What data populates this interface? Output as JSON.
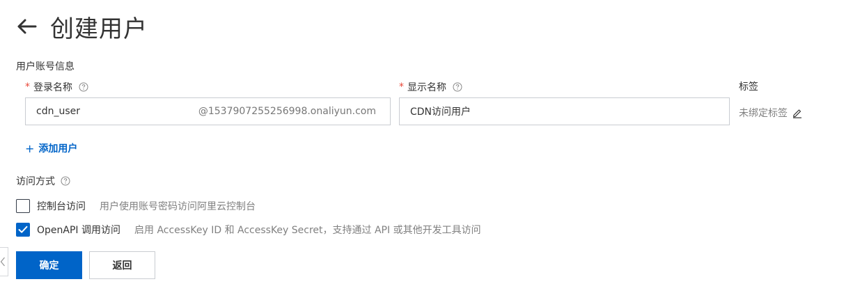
{
  "header": {
    "title": "创建用户",
    "back_icon": "arrow-left-icon"
  },
  "form": {
    "section_title": "用户账号信息",
    "login_name": {
      "label": "登录名称",
      "required": "*",
      "value": "cdn_user",
      "suffix": "@1537907255256998.onaliyun.com"
    },
    "display_name": {
      "label": "显示名称",
      "required": "*",
      "value": "CDN访问用户"
    },
    "tags": {
      "label": "标签",
      "value": "未绑定标签"
    },
    "add_user_label": "添加用户",
    "add_user_plus": "+"
  },
  "access": {
    "title": "访问方式",
    "options": [
      {
        "label": "控制台访问",
        "description": "用户使用账号密码访问阿里云控制台",
        "checked": false
      },
      {
        "label": "OpenAPI 调用访问",
        "description": "启用 AccessKey ID 和 AccessKey Secret，支持通过 API 或其他开发工具访问",
        "checked": true
      }
    ]
  },
  "buttons": {
    "confirm": "确定",
    "back": "返回"
  },
  "colors": {
    "primary": "#0064c8",
    "required": "#e84738",
    "border": "#c9ccd1",
    "muted": "#808080"
  }
}
